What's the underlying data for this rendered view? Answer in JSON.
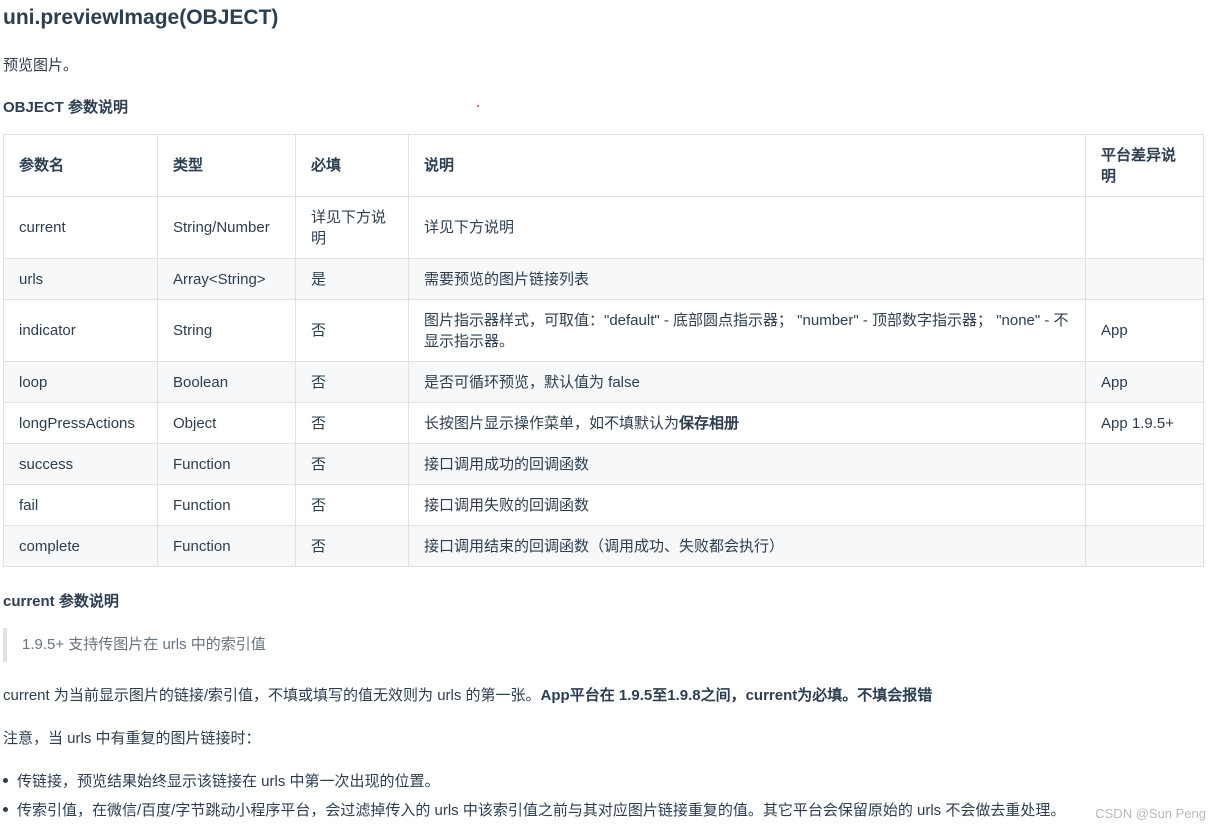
{
  "title": "uni.previewImage(OBJECT)",
  "description": "预览图片。",
  "object_heading": "OBJECT 参数说明",
  "table": {
    "headers": [
      "参数名",
      "类型",
      "必填",
      "说明",
      "平台差异说明"
    ],
    "rows": [
      [
        "current",
        "String/Number",
        "详见下方说明",
        "详见下方说明",
        ""
      ],
      [
        "urls",
        "Array<String>",
        "是",
        "需要预览的图片链接列表",
        ""
      ],
      [
        "indicator",
        "String",
        "否",
        "图片指示器样式，可取值：\"default\" - 底部圆点指示器； \"number\" - 顶部数字指示器； \"none\" - 不显示指示器。",
        "App"
      ],
      [
        "loop",
        "Boolean",
        "否",
        "是否可循环预览，默认值为 false",
        "App"
      ],
      [
        "longPressActions",
        "Object",
        "否",
        "长按图片显示操作菜单，如不填默认为",
        "App 1.9.5+"
      ],
      [
        "success",
        "Function",
        "否",
        "接口调用成功的回调函数",
        ""
      ],
      [
        "fail",
        "Function",
        "否",
        "接口调用失败的回调函数",
        ""
      ],
      [
        "complete",
        "Function",
        "否",
        "接口调用结束的回调函数（调用成功、失败都会执行）",
        ""
      ]
    ],
    "longpress_bold": "保存相册"
  },
  "current_heading": "current 参数说明",
  "blockquote": "1.9.5+ 支持传图片在 urls 中的索引值",
  "current_para": {
    "normal": "current 为当前显示图片的链接/索引值，不填或填写的值无效则为 urls 的第一张。",
    "bold": "App平台在 1.9.5至1.9.8之间，current为必填。不填会报错"
  },
  "note": "注意，当 urls 中有重复的图片链接时：",
  "bullets": [
    "传链接，预览结果始终显示该链接在 urls 中第一次出现的位置。",
    "传索引值，在微信/百度/字节跳动小程序平台，会过滤掉传入的 urls 中该索引值之前与其对应图片链接重复的值。其它平台会保留原始的 urls 不会做去重处理。"
  ],
  "watermark": "CSDN @Sun   Peng"
}
